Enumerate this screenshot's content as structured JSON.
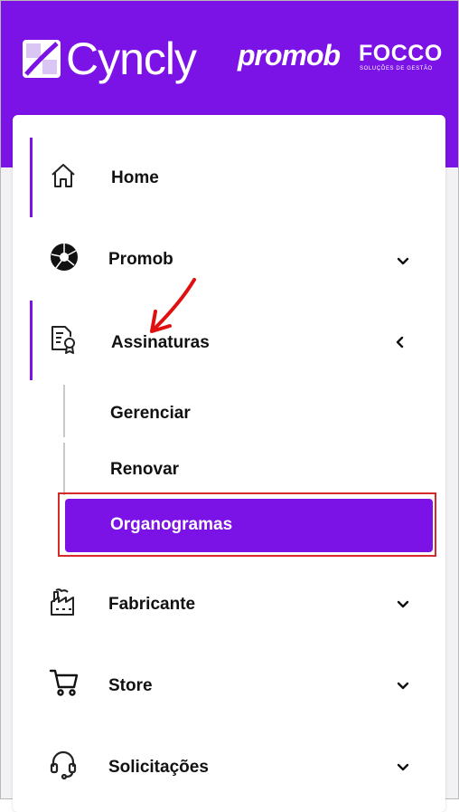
{
  "brand": {
    "name": "Cyncly",
    "partner1": "promob",
    "partner2": "FOCCO",
    "partner2_sub": "SOLUÇÕES DE GESTÃO"
  },
  "nav": {
    "home": "Home",
    "promob": "Promob",
    "assinaturas": "Assinaturas",
    "sub": {
      "gerenciar": "Gerenciar",
      "renovar": "Renovar",
      "organogramas": "Organogramas"
    },
    "fabricante": "Fabricante",
    "store": "Store",
    "solicitacoes": "Solicitações"
  },
  "colors": {
    "brand_purple": "#7b12e6",
    "annotation_red": "#d52a2a"
  }
}
